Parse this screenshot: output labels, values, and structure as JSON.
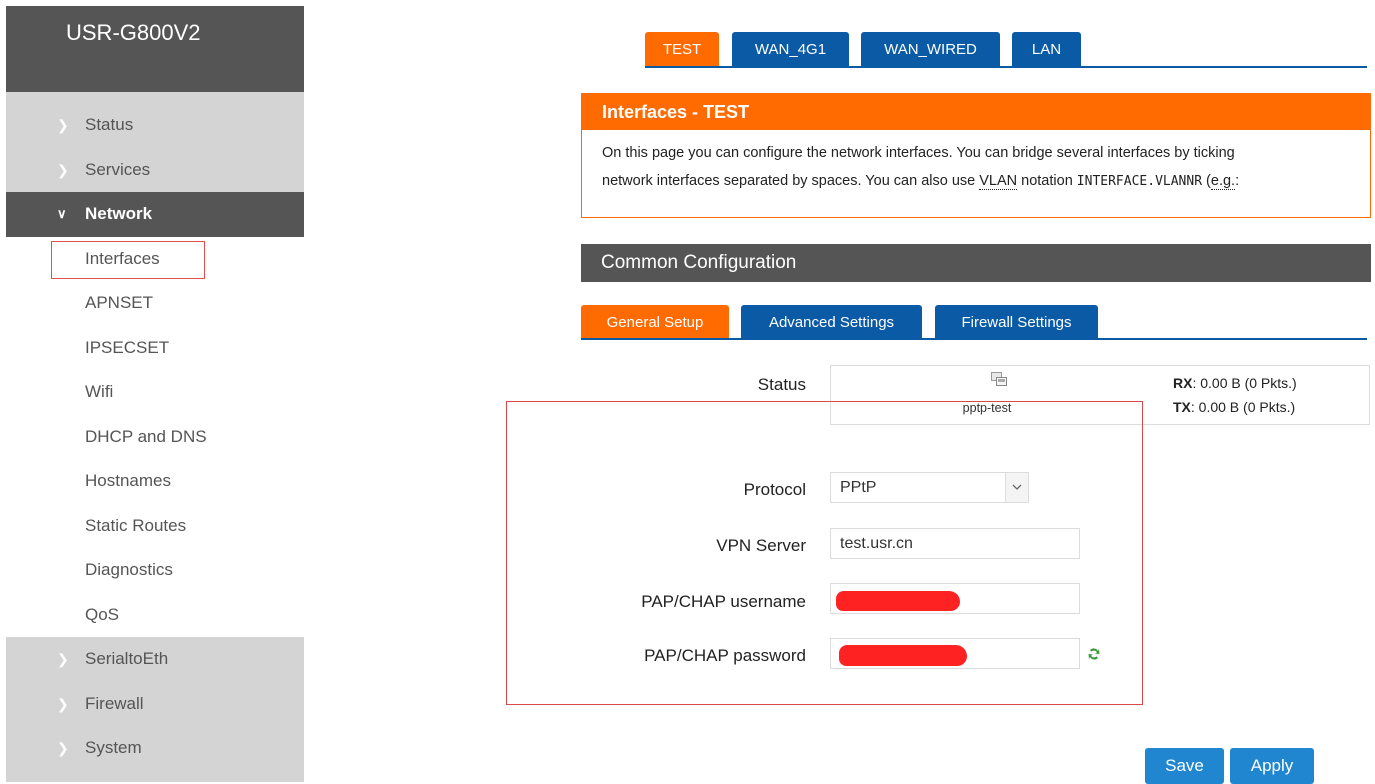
{
  "brand": "USR-G800V2",
  "sidebar": {
    "menu_before": [
      {
        "label": "Status"
      },
      {
        "label": "Services"
      }
    ],
    "active": {
      "label": "Network"
    },
    "sub_items": [
      {
        "label": "Interfaces",
        "selected": true
      },
      {
        "label": "APNSET"
      },
      {
        "label": "IPSECSET"
      },
      {
        "label": "Wifi"
      },
      {
        "label": "DHCP and DNS"
      },
      {
        "label": "Hostnames"
      },
      {
        "label": "Static Routes"
      },
      {
        "label": "Diagnostics"
      },
      {
        "label": "QoS"
      }
    ],
    "menu_after": [
      {
        "label": "SerialtoEth"
      },
      {
        "label": "Firewall"
      },
      {
        "label": "System"
      }
    ]
  },
  "top_tabs": [
    {
      "label": "TEST",
      "active": true
    },
    {
      "label": "WAN_4G1"
    },
    {
      "label": "WAN_WIRED"
    },
    {
      "label": "LAN"
    }
  ],
  "info": {
    "title": "Interfaces - TEST",
    "line1": "On this page you can configure the network interfaces. You can bridge several interfaces by ticking",
    "line2_pre": "network interfaces separated by spaces. You can also use ",
    "line2_abbr": "VLAN",
    "line2_mid": " notation ",
    "line2_code": "INTERFACE.VLANNR",
    "line2_post": " (",
    "line2_eg": "e.g.",
    "line2_end": ":"
  },
  "section_title": "Common Configuration",
  "sub_tabs": [
    {
      "label": "General Setup",
      "active": true
    },
    {
      "label": "Advanced Settings"
    },
    {
      "label": "Firewall Settings"
    }
  ],
  "status": {
    "label": "Status",
    "device_name": "pptp-test",
    "rx_label": "RX",
    "rx_value": ": 0.00 B (0 Pkts.)",
    "tx_label": "TX",
    "tx_value": ": 0.00 B (0 Pkts.)"
  },
  "form": {
    "protocol_label": "Protocol",
    "protocol_value": "PPtP",
    "vpn_label": "VPN Server",
    "vpn_value": "test.usr.cn",
    "user_label": "PAP/CHAP username",
    "pass_label": "PAP/CHAP password"
  },
  "buttons": {
    "save": "Save",
    "apply": "Apply"
  },
  "colors": {
    "orange": "#ff6b00",
    "blue": "#0a5aa5",
    "dark": "#555555",
    "sidebar": "#d4d4d4",
    "highlight": "#d9494a",
    "redaction": "#ff2222"
  },
  "icons": [
    "chevron-right-icon",
    "chevron-down-icon",
    "network-device-icon",
    "select-arrow-icon",
    "refresh-icon"
  ]
}
